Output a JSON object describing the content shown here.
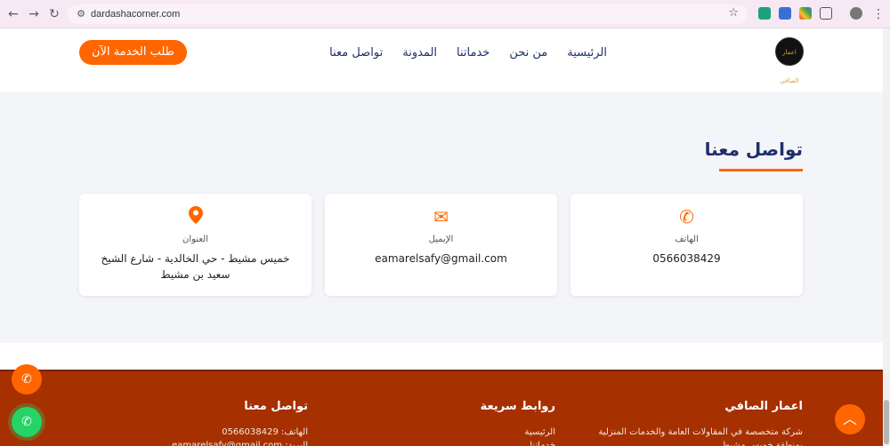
{
  "browser": {
    "url": "dardashacorner.com",
    "back_icon": "←",
    "forward_icon": "→",
    "reload_icon": "↻"
  },
  "header": {
    "logo_text": "اعمار الصافي",
    "menu": [
      "الرئيسية",
      "من نحن",
      "خدماتنا",
      "المدونة",
      "تواصل معنا"
    ],
    "cta": "طلب الخدمة الآن"
  },
  "contact": {
    "title": "تواصل معنا",
    "cards": [
      {
        "icon": "phone-icon",
        "label": "الهاتف",
        "value": "0566038429"
      },
      {
        "icon": "envelope-icon",
        "label": "الإيميل",
        "value": "eamarelsafy@gmail.com"
      },
      {
        "icon": "map-pin-icon",
        "label": "العنوان",
        "value": "خميس مشيط - حي الخالدية - شارع الشيخ سعيد بن مشيط"
      }
    ]
  },
  "footer": {
    "about": {
      "title": "اعمار الصافي",
      "text": "شركة متخصصة في المقاولات العامة والخدمات المنزلية بمنطقة خميس مشيط"
    },
    "links": {
      "title": "روابط سريعة",
      "items": [
        "الرئيسية",
        "خدماتنا"
      ]
    },
    "contact": {
      "title": "تواصل معنا",
      "phone": "الهاتف: 0566038429",
      "email": "البريد: eamarelsafy@gmail.com"
    }
  },
  "colors": {
    "accent": "#ff6600",
    "navy": "#1f2f6b",
    "footer": "#a63000",
    "whatsapp": "#25d366"
  }
}
